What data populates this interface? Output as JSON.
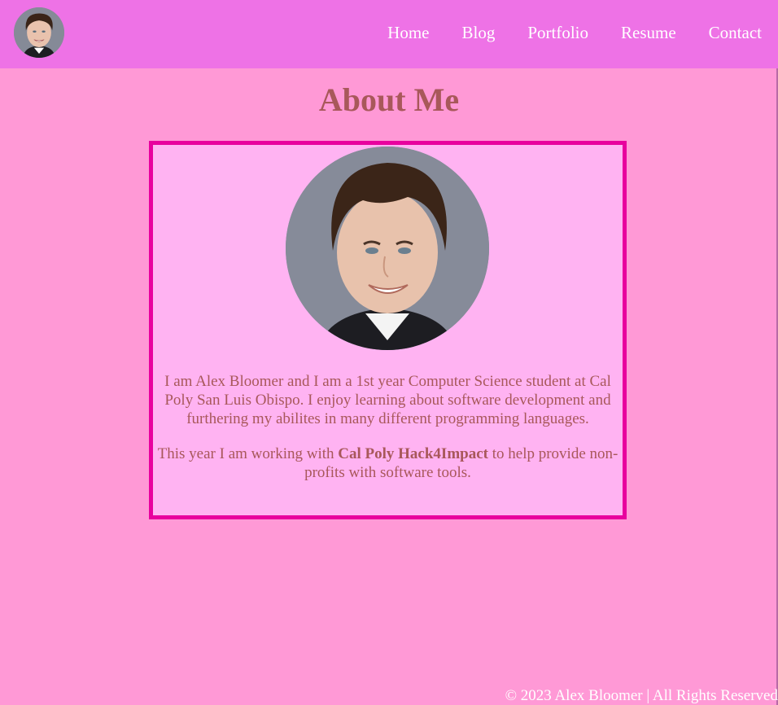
{
  "nav": {
    "links": [
      "Home",
      "Blog",
      "Portfolio",
      "Resume",
      "Contact"
    ]
  },
  "main": {
    "title": "About Me",
    "bio_paragraph_1": "I am Alex Bloomer and I am a 1st year Computer Science student at Cal Poly San Luis Obispo. I enjoy learning about software development and furthering my abilites in many different programming languages.",
    "bio_paragraph_2_before": "This year I am working with ",
    "bio_paragraph_2_strong": "Cal Poly Hack4Impact",
    "bio_paragraph_2_after": " to help provide non-profits with software tools."
  },
  "footer": {
    "text": "© 2023 Alex Bloomer | All Rights Reserved"
  },
  "colors": {
    "background": "#ff99d6",
    "navbar": "#ee72e6",
    "card": "#ffb3f2",
    "card_border": "#e8009e",
    "text": "#a8585a"
  }
}
